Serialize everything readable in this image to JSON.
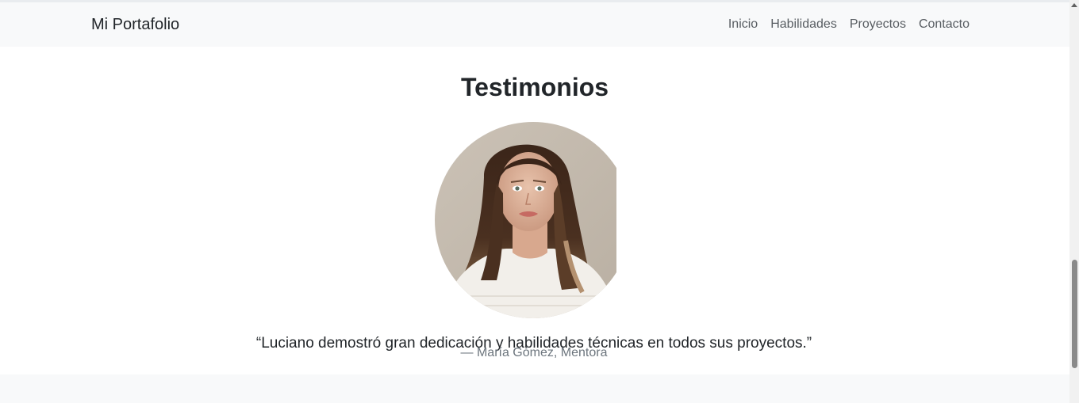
{
  "navbar": {
    "brand": "Mi Portafolio",
    "links": [
      "Inicio",
      "Habilidades",
      "Proyectos",
      "Contacto"
    ]
  },
  "testimonials": {
    "title": "Testimonios",
    "quote": "“Luciano demostró gran dedicación y habilidades técnicas en todos sus proyectos.”",
    "author": "— María Gómez, Mentora",
    "avatar_icon": "portrait-photo"
  },
  "scrollbar": {
    "position_fraction": 0.78
  },
  "colors": {
    "navbar_bg": "#f8f9fa",
    "text": "#212529",
    "muted": "#6c757d"
  }
}
